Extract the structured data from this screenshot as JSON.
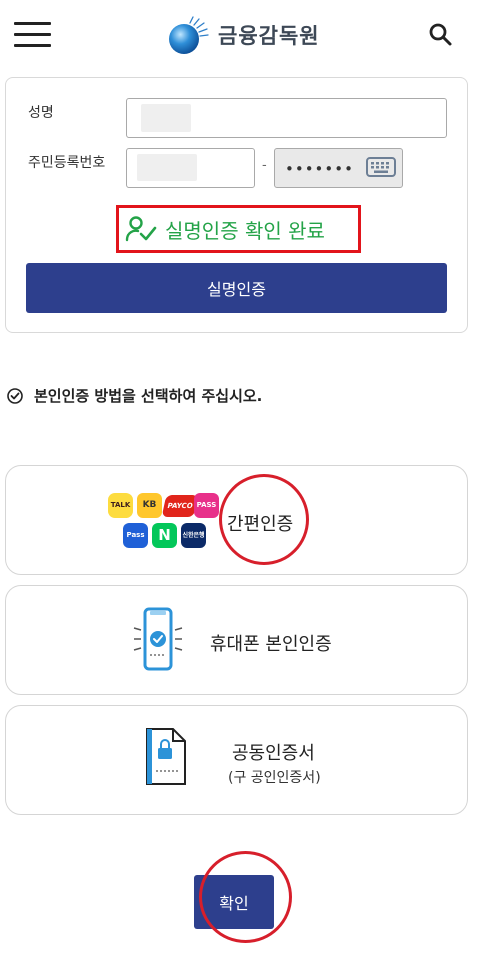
{
  "header": {
    "menu_icon": "hamburger-menu-icon",
    "title": "금융감독원",
    "search_icon": "search-icon"
  },
  "form": {
    "name_label": "성명",
    "rrn_label": "주민등록번호",
    "rrn_separator": "-",
    "rrn_back_value": "•••••••",
    "keyboard_icon": "keyboard-icon",
    "verified_text": "실명인증 확인 완료",
    "verify_button": "실명인증"
  },
  "instruction": {
    "icon": "check-circle-icon",
    "text": "본인인증 방법을 선택하여 주십시오."
  },
  "methods": [
    {
      "label": "간편인증",
      "sub": "",
      "icon": "simple-auth-apps-icon",
      "apps": [
        "TALK",
        "KB",
        "PAYCO",
        "PASS",
        "Pass",
        "N",
        "신한은행"
      ]
    },
    {
      "label": "휴대폰 본인인증",
      "sub": "",
      "icon": "mobile-phone-check-icon"
    },
    {
      "label": "공동인증서",
      "sub": "(구 공인인증서)",
      "icon": "certificate-lock-icon"
    }
  ],
  "confirm_button": "확인",
  "colors": {
    "primary": "#2d3f8d",
    "success": "#24a348",
    "highlight_red": "#e2141b"
  }
}
